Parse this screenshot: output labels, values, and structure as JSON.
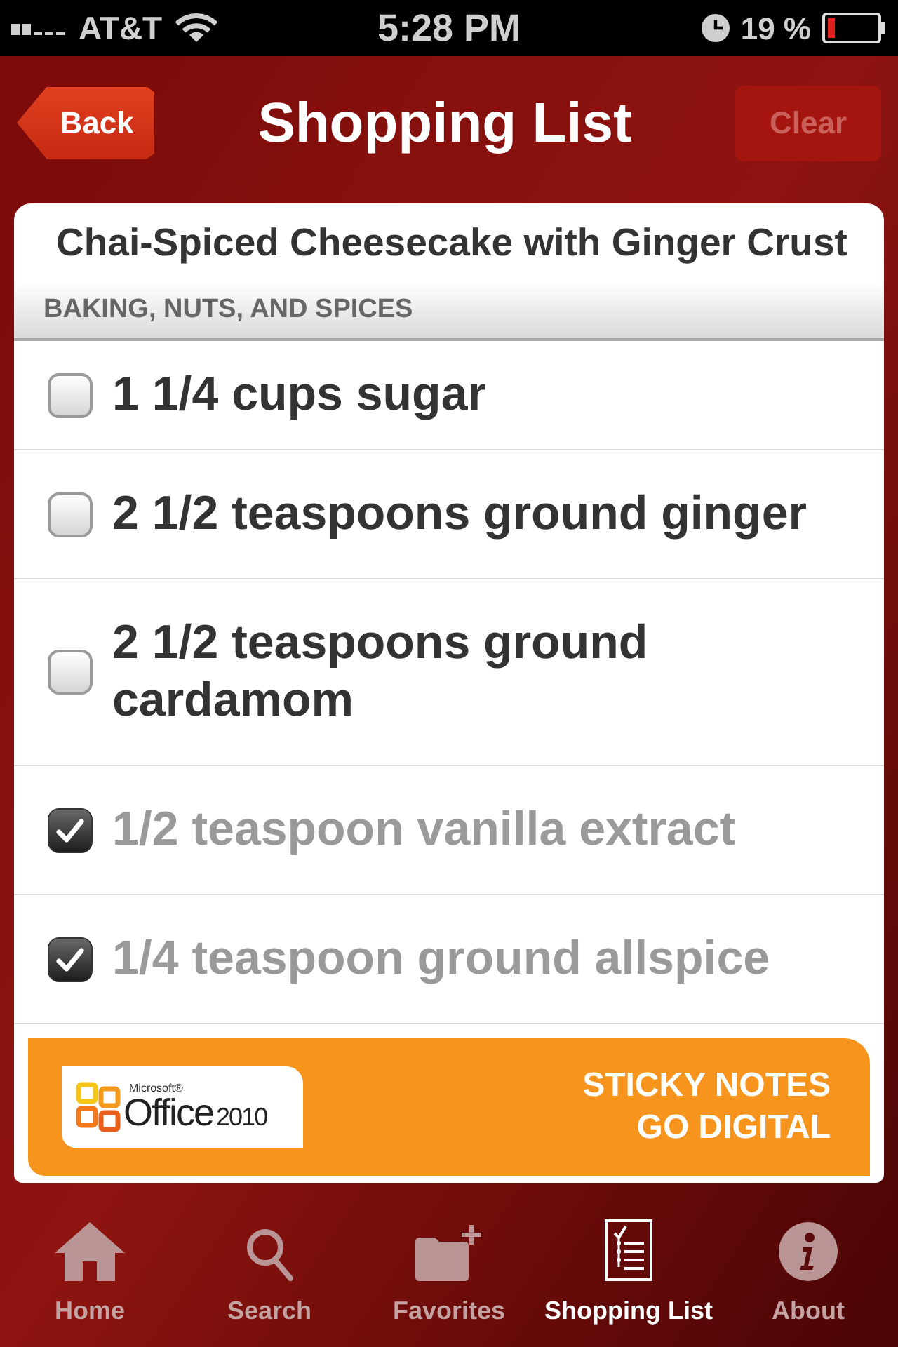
{
  "status_bar": {
    "carrier": "AT&T",
    "time": "5:28 PM",
    "battery": "19 %"
  },
  "nav_bar": {
    "back_button": "Back",
    "title": "Shopping List",
    "clear_button": {
      "label": "Clear",
      "disabled": true
    }
  },
  "recipe": {
    "title": "Chai-Spiced Cheesecake with Ginger Crust",
    "section": "BAKING, NUTS, AND SPICES",
    "items": [
      {
        "text": "1 1/4 cups sugar",
        "checked": false
      },
      {
        "text": "2 1/2 teaspoons ground ginger",
        "checked": false
      },
      {
        "text": "2 1/2 teaspoons ground cardamom",
        "checked": false
      },
      {
        "text": "1/2 teaspoon vanilla extract",
        "checked": true
      },
      {
        "text": "1/4 teaspoon ground allspice",
        "checked": true
      }
    ]
  },
  "ad": {
    "brand_small": "Microsoft®",
    "brand": "Office",
    "year": "2010",
    "headline": [
      "STICKY NOTES",
      "GO DIGITAL"
    ]
  },
  "tab_bar": {
    "tabs": [
      {
        "label": "Home",
        "selected": false
      },
      {
        "label": "Search",
        "selected": false
      },
      {
        "label": "Favorites",
        "selected": false
      },
      {
        "label": "Shopping List",
        "selected": true
      },
      {
        "label": "About",
        "selected": false
      }
    ]
  }
}
